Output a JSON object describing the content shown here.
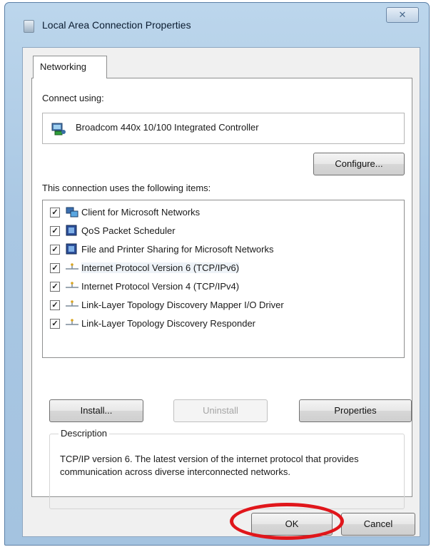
{
  "window": {
    "title": "Local Area Connection Properties",
    "close_glyph": "✕"
  },
  "tabs": [
    {
      "label": "Networking"
    }
  ],
  "connect": {
    "label": "Connect using:",
    "adapter": "Broadcom 440x 10/100 Integrated Controller",
    "adapter_icon": "network-adapter-icon",
    "configure_label": "Configure..."
  },
  "items": {
    "label": "This connection uses the following items:",
    "list": [
      {
        "label": "Client for Microsoft Networks",
        "checked": true,
        "icon": "network-client-icon"
      },
      {
        "label": "QoS Packet Scheduler",
        "checked": true,
        "icon": "network-service-icon"
      },
      {
        "label": "File and Printer Sharing for Microsoft Networks",
        "checked": true,
        "icon": "network-service-icon"
      },
      {
        "label": "Internet Protocol Version 6 (TCP/IPv6)",
        "checked": true,
        "icon": "protocol-icon",
        "selected": true
      },
      {
        "label": "Internet Protocol Version 4 (TCP/IPv4)",
        "checked": true,
        "icon": "protocol-icon"
      },
      {
        "label": "Link-Layer Topology Discovery Mapper I/O Driver",
        "checked": true,
        "icon": "protocol-icon"
      },
      {
        "label": "Link-Layer Topology Discovery Responder",
        "checked": true,
        "icon": "protocol-icon"
      }
    ]
  },
  "buttons": {
    "install": "Install...",
    "uninstall": "Uninstall",
    "properties": "Properties"
  },
  "description": {
    "title": "Description",
    "text": "TCP/IP version 6. The latest version of the internet protocol that provides communication across diverse interconnected networks."
  },
  "footer": {
    "ok": "OK",
    "cancel": "Cancel"
  },
  "highlight_color": "#e0161b"
}
